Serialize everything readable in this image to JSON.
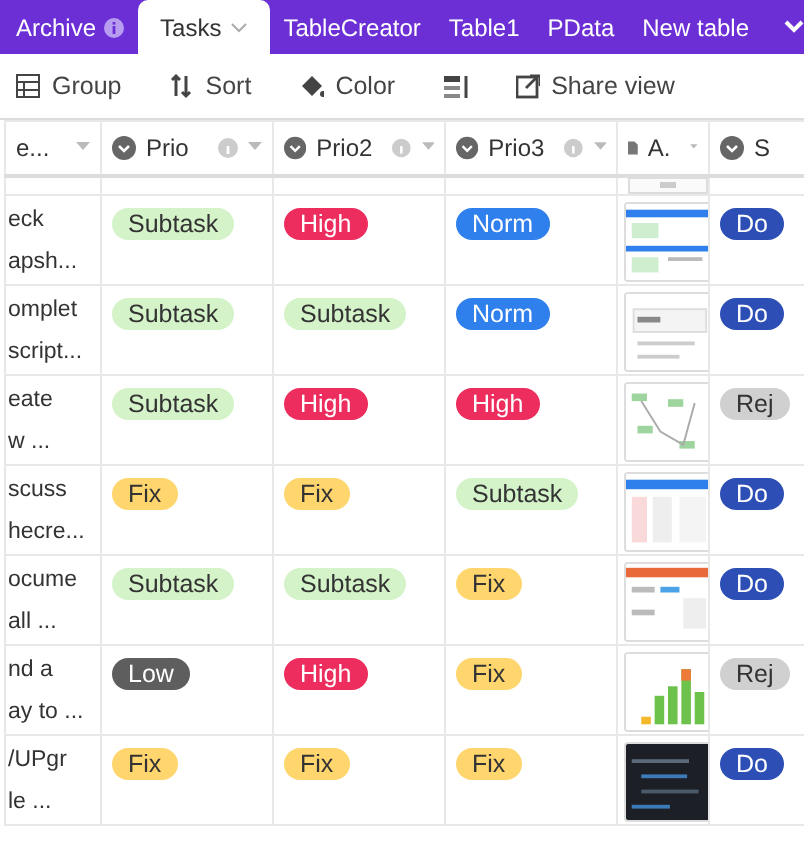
{
  "tabs": [
    {
      "label": "Archive",
      "selected": false,
      "info": true
    },
    {
      "label": "Tasks",
      "selected": true,
      "caret": true
    },
    {
      "label": "TableCreator",
      "selected": false
    },
    {
      "label": "Table1",
      "selected": false
    },
    {
      "label": "PData",
      "selected": false
    },
    {
      "label": "New table",
      "selected": false
    }
  ],
  "toolbar": [
    {
      "kind": "group",
      "label": "Group"
    },
    {
      "kind": "sort",
      "label": "Sort"
    },
    {
      "kind": "color",
      "label": "Color"
    },
    {
      "kind": "height"
    },
    {
      "kind": "share",
      "label": "Share view"
    }
  ],
  "columns": [
    {
      "label": "e...",
      "kind": "text"
    },
    {
      "label": "Prio",
      "kind": "select",
      "info": true
    },
    {
      "label": "Prio2",
      "kind": "select",
      "info": true
    },
    {
      "label": "Prio3",
      "kind": "select",
      "info": true
    },
    {
      "label": "A.",
      "kind": "file"
    },
    {
      "label": "S",
      "kind": "select"
    }
  ],
  "rows": [
    {
      "lines": [
        "eck",
        "apsh..."
      ],
      "tags": [
        {
          "text": "Subtask",
          "color": "#d4f3c8"
        },
        {
          "text": "High",
          "color": "#ec2d5e"
        },
        {
          "text": "Norm",
          "color": "#2f80ed"
        }
      ],
      "status": {
        "text": "Do",
        "color": "#2d4fb5"
      }
    },
    {
      "lines": [
        "omplet",
        "script..."
      ],
      "tags": [
        {
          "text": "Subtask",
          "color": "#d4f3c8"
        },
        {
          "text": "Subtask",
          "color": "#d4f3c8"
        },
        {
          "text": "Norm",
          "color": "#2f80ed"
        }
      ],
      "status": {
        "text": "Do",
        "color": "#2d4fb5"
      }
    },
    {
      "lines": [
        "eate",
        "w ..."
      ],
      "tags": [
        {
          "text": "Subtask",
          "color": "#d4f3c8"
        },
        {
          "text": "High",
          "color": "#ec2d5e"
        },
        {
          "text": "High",
          "color": "#ec2d5e"
        }
      ],
      "status": {
        "text": "Rej",
        "color": "#d0d0d0"
      }
    },
    {
      "lines": [
        "scuss",
        "hecre..."
      ],
      "tags": [
        {
          "text": "Fix",
          "color": "#ffd66e"
        },
        {
          "text": "Fix",
          "color": "#ffd66e"
        },
        {
          "text": "Subtask",
          "color": "#d4f3c8"
        }
      ],
      "status": {
        "text": "Do",
        "color": "#2d4fb5"
      }
    },
    {
      "lines": [
        "ocume",
        "all ..."
      ],
      "tags": [
        {
          "text": "Subtask",
          "color": "#d4f3c8"
        },
        {
          "text": "Subtask",
          "color": "#d4f3c8"
        },
        {
          "text": "Fix",
          "color": "#ffd66e"
        }
      ],
      "status": {
        "text": "Do",
        "color": "#2d4fb5"
      }
    },
    {
      "lines": [
        "nd a",
        "ay to ..."
      ],
      "tags": [
        {
          "text": "Low",
          "color": "#5e5e5e"
        },
        {
          "text": "High",
          "color": "#ec2d5e"
        },
        {
          "text": "Fix",
          "color": "#ffd66e"
        }
      ],
      "status": {
        "text": "Rej",
        "color": "#d0d0d0"
      }
    },
    {
      "lines": [
        "/UPgr",
        "le ..."
      ],
      "tags": [
        {
          "text": "Fix",
          "color": "#ffd66e"
        },
        {
          "text": "Fix",
          "color": "#ffd66e"
        },
        {
          "text": "Fix",
          "color": "#ffd66e"
        }
      ],
      "status": {
        "text": "Do",
        "color": "#2d4fb5"
      }
    }
  ]
}
